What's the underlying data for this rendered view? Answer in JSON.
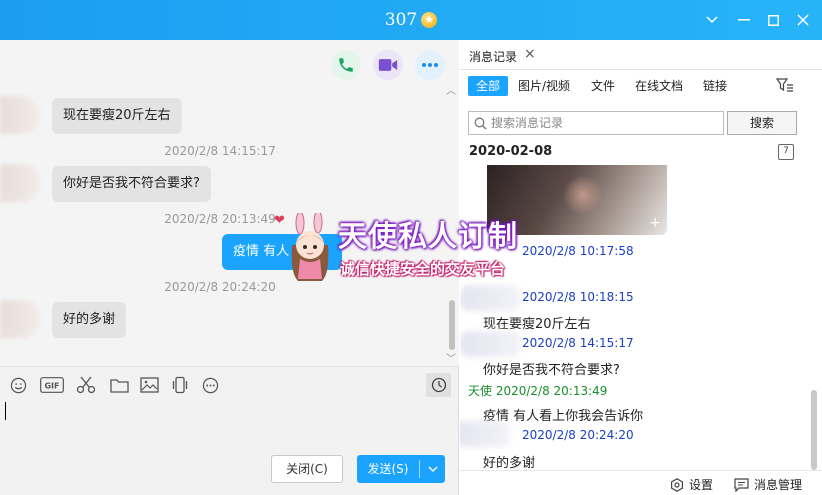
{
  "window": {
    "title": "307",
    "badge": "★"
  },
  "chat": {
    "messages": [
      {
        "side": "them",
        "text": "现在要瘦20斤左右"
      },
      {
        "side": "time",
        "text": "2020/2/8 14:15:17"
      },
      {
        "side": "them",
        "text": "你好是否我不符合要求?"
      },
      {
        "side": "time",
        "text": "2020/2/8 20:13:49"
      },
      {
        "side": "me",
        "text": "疫情 有人看上你我会告诉你"
      },
      {
        "side": "time",
        "text": "2020/2/8 20:24:20"
      },
      {
        "side": "them",
        "text": "好的多谢"
      }
    ],
    "me_bubble_visible_text": "疫情 有人",
    "me_bubble_tail_text": "诉你",
    "close_label": "关闭(C)",
    "send_label": "发送(S)"
  },
  "history": {
    "tab_label": "消息记录",
    "filters": [
      "全部",
      "图片/视频",
      "文件",
      "在线文档",
      "链接"
    ],
    "search_placeholder": "搜索消息记录",
    "search_button": "搜索",
    "date_header": "2020-02-08",
    "calendar_label": "7",
    "entries": [
      {
        "type": "time",
        "owner": "them",
        "text": "2020/2/8 10:17:58"
      },
      {
        "type": "time",
        "owner": "them",
        "text": "2020/2/8 10:18:15"
      },
      {
        "type": "text",
        "text": "现在要瘦20斤左右"
      },
      {
        "type": "time",
        "owner": "them",
        "text": "2020/2/8 14:15:17"
      },
      {
        "type": "text",
        "text": "你好是否我不符合要求?"
      },
      {
        "type": "time",
        "owner": "me",
        "text": "天使 2020/2/8 20:13:49"
      },
      {
        "type": "text",
        "text": "疫情 有人看上你我会告诉你"
      },
      {
        "type": "time",
        "owner": "them",
        "text": "2020/2/8 20:24:20"
      },
      {
        "type": "text",
        "text": "好的多谢"
      }
    ],
    "settings_label": "设置",
    "manage_label": "消息管理"
  },
  "ad": {
    "title": "天使私人订制",
    "subtitle": "诚信快捷安全的交友平台"
  },
  "colors": {
    "accent": "#1aa3ff",
    "titlebar": "#1b9ef2",
    "time_them": "#1a3fc4",
    "time_me": "#1a8f2e"
  }
}
